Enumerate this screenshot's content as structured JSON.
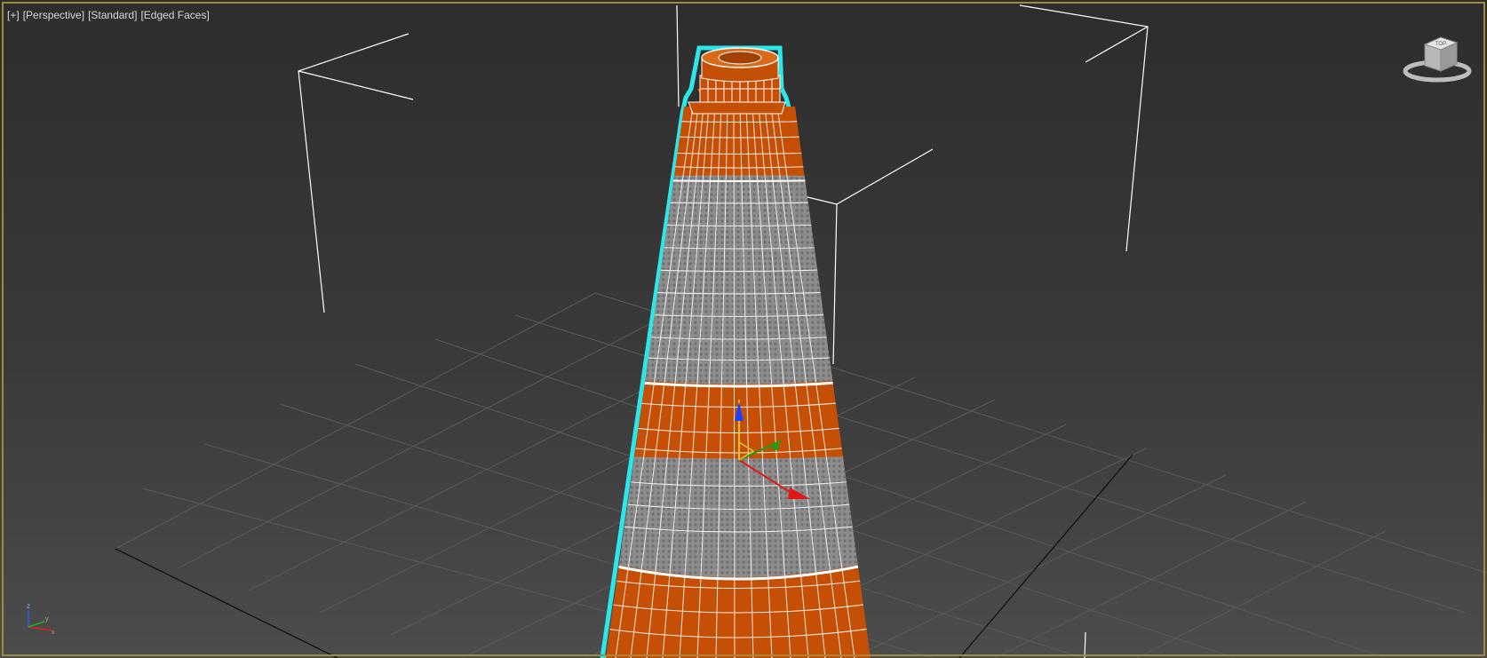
{
  "viewport": {
    "labels": [
      "[+]",
      "[Perspective]",
      "[Standard]",
      "[Edged Faces]"
    ]
  },
  "viewcube": {
    "face_label": "TOP"
  },
  "axis_tripod": {
    "z": "z",
    "x": "x",
    "y": "y"
  },
  "colors": {
    "selection": "#2de6ea",
    "cone_orange": "#c44f05",
    "reflective_band": "#8c8c8c",
    "wire": "#ffffff",
    "frame": "#a08a3c",
    "gizmo_z": "#1e40ff",
    "gizmo_x": "#e01818",
    "gizmo_y": "#18a018"
  },
  "icons": [
    "viewcube-icon",
    "axis-tripod-icon",
    "transform-gizmo-icon"
  ]
}
